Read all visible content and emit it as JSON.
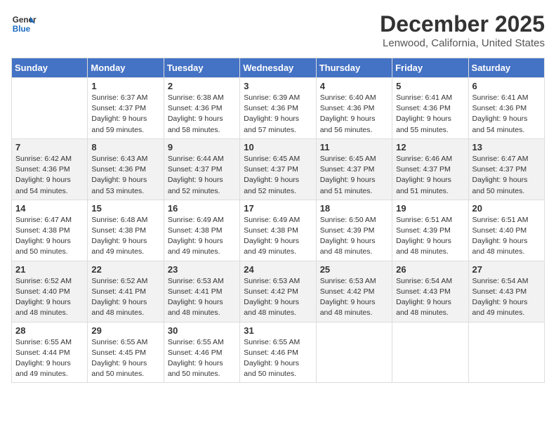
{
  "header": {
    "logo_line1": "General",
    "logo_line2": "Blue",
    "month": "December 2025",
    "location": "Lenwood, California, United States"
  },
  "weekdays": [
    "Sunday",
    "Monday",
    "Tuesday",
    "Wednesday",
    "Thursday",
    "Friday",
    "Saturday"
  ],
  "weeks": [
    [
      {
        "day": "",
        "sunrise": "",
        "sunset": "",
        "daylight": ""
      },
      {
        "day": "1",
        "sunrise": "Sunrise: 6:37 AM",
        "sunset": "Sunset: 4:37 PM",
        "daylight": "Daylight: 9 hours and 59 minutes."
      },
      {
        "day": "2",
        "sunrise": "Sunrise: 6:38 AM",
        "sunset": "Sunset: 4:36 PM",
        "daylight": "Daylight: 9 hours and 58 minutes."
      },
      {
        "day": "3",
        "sunrise": "Sunrise: 6:39 AM",
        "sunset": "Sunset: 4:36 PM",
        "daylight": "Daylight: 9 hours and 57 minutes."
      },
      {
        "day": "4",
        "sunrise": "Sunrise: 6:40 AM",
        "sunset": "Sunset: 4:36 PM",
        "daylight": "Daylight: 9 hours and 56 minutes."
      },
      {
        "day": "5",
        "sunrise": "Sunrise: 6:41 AM",
        "sunset": "Sunset: 4:36 PM",
        "daylight": "Daylight: 9 hours and 55 minutes."
      },
      {
        "day": "6",
        "sunrise": "Sunrise: 6:41 AM",
        "sunset": "Sunset: 4:36 PM",
        "daylight": "Daylight: 9 hours and 54 minutes."
      }
    ],
    [
      {
        "day": "7",
        "sunrise": "Sunrise: 6:42 AM",
        "sunset": "Sunset: 4:36 PM",
        "daylight": "Daylight: 9 hours and 54 minutes."
      },
      {
        "day": "8",
        "sunrise": "Sunrise: 6:43 AM",
        "sunset": "Sunset: 4:36 PM",
        "daylight": "Daylight: 9 hours and 53 minutes."
      },
      {
        "day": "9",
        "sunrise": "Sunrise: 6:44 AM",
        "sunset": "Sunset: 4:37 PM",
        "daylight": "Daylight: 9 hours and 52 minutes."
      },
      {
        "day": "10",
        "sunrise": "Sunrise: 6:45 AM",
        "sunset": "Sunset: 4:37 PM",
        "daylight": "Daylight: 9 hours and 52 minutes."
      },
      {
        "day": "11",
        "sunrise": "Sunrise: 6:45 AM",
        "sunset": "Sunset: 4:37 PM",
        "daylight": "Daylight: 9 hours and 51 minutes."
      },
      {
        "day": "12",
        "sunrise": "Sunrise: 6:46 AM",
        "sunset": "Sunset: 4:37 PM",
        "daylight": "Daylight: 9 hours and 51 minutes."
      },
      {
        "day": "13",
        "sunrise": "Sunrise: 6:47 AM",
        "sunset": "Sunset: 4:37 PM",
        "daylight": "Daylight: 9 hours and 50 minutes."
      }
    ],
    [
      {
        "day": "14",
        "sunrise": "Sunrise: 6:47 AM",
        "sunset": "Sunset: 4:38 PM",
        "daylight": "Daylight: 9 hours and 50 minutes."
      },
      {
        "day": "15",
        "sunrise": "Sunrise: 6:48 AM",
        "sunset": "Sunset: 4:38 PM",
        "daylight": "Daylight: 9 hours and 49 minutes."
      },
      {
        "day": "16",
        "sunrise": "Sunrise: 6:49 AM",
        "sunset": "Sunset: 4:38 PM",
        "daylight": "Daylight: 9 hours and 49 minutes."
      },
      {
        "day": "17",
        "sunrise": "Sunrise: 6:49 AM",
        "sunset": "Sunset: 4:38 PM",
        "daylight": "Daylight: 9 hours and 49 minutes."
      },
      {
        "day": "18",
        "sunrise": "Sunrise: 6:50 AM",
        "sunset": "Sunset: 4:39 PM",
        "daylight": "Daylight: 9 hours and 48 minutes."
      },
      {
        "day": "19",
        "sunrise": "Sunrise: 6:51 AM",
        "sunset": "Sunset: 4:39 PM",
        "daylight": "Daylight: 9 hours and 48 minutes."
      },
      {
        "day": "20",
        "sunrise": "Sunrise: 6:51 AM",
        "sunset": "Sunset: 4:40 PM",
        "daylight": "Daylight: 9 hours and 48 minutes."
      }
    ],
    [
      {
        "day": "21",
        "sunrise": "Sunrise: 6:52 AM",
        "sunset": "Sunset: 4:40 PM",
        "daylight": "Daylight: 9 hours and 48 minutes."
      },
      {
        "day": "22",
        "sunrise": "Sunrise: 6:52 AM",
        "sunset": "Sunset: 4:41 PM",
        "daylight": "Daylight: 9 hours and 48 minutes."
      },
      {
        "day": "23",
        "sunrise": "Sunrise: 6:53 AM",
        "sunset": "Sunset: 4:41 PM",
        "daylight": "Daylight: 9 hours and 48 minutes."
      },
      {
        "day": "24",
        "sunrise": "Sunrise: 6:53 AM",
        "sunset": "Sunset: 4:42 PM",
        "daylight": "Daylight: 9 hours and 48 minutes."
      },
      {
        "day": "25",
        "sunrise": "Sunrise: 6:53 AM",
        "sunset": "Sunset: 4:42 PM",
        "daylight": "Daylight: 9 hours and 48 minutes."
      },
      {
        "day": "26",
        "sunrise": "Sunrise: 6:54 AM",
        "sunset": "Sunset: 4:43 PM",
        "daylight": "Daylight: 9 hours and 48 minutes."
      },
      {
        "day": "27",
        "sunrise": "Sunrise: 6:54 AM",
        "sunset": "Sunset: 4:43 PM",
        "daylight": "Daylight: 9 hours and 49 minutes."
      }
    ],
    [
      {
        "day": "28",
        "sunrise": "Sunrise: 6:55 AM",
        "sunset": "Sunset: 4:44 PM",
        "daylight": "Daylight: 9 hours and 49 minutes."
      },
      {
        "day": "29",
        "sunrise": "Sunrise: 6:55 AM",
        "sunset": "Sunset: 4:45 PM",
        "daylight": "Daylight: 9 hours and 50 minutes."
      },
      {
        "day": "30",
        "sunrise": "Sunrise: 6:55 AM",
        "sunset": "Sunset: 4:46 PM",
        "daylight": "Daylight: 9 hours and 50 minutes."
      },
      {
        "day": "31",
        "sunrise": "Sunrise: 6:55 AM",
        "sunset": "Sunset: 4:46 PM",
        "daylight": "Daylight: 9 hours and 50 minutes."
      },
      {
        "day": "",
        "sunrise": "",
        "sunset": "",
        "daylight": ""
      },
      {
        "day": "",
        "sunrise": "",
        "sunset": "",
        "daylight": ""
      },
      {
        "day": "",
        "sunrise": "",
        "sunset": "",
        "daylight": ""
      }
    ]
  ]
}
